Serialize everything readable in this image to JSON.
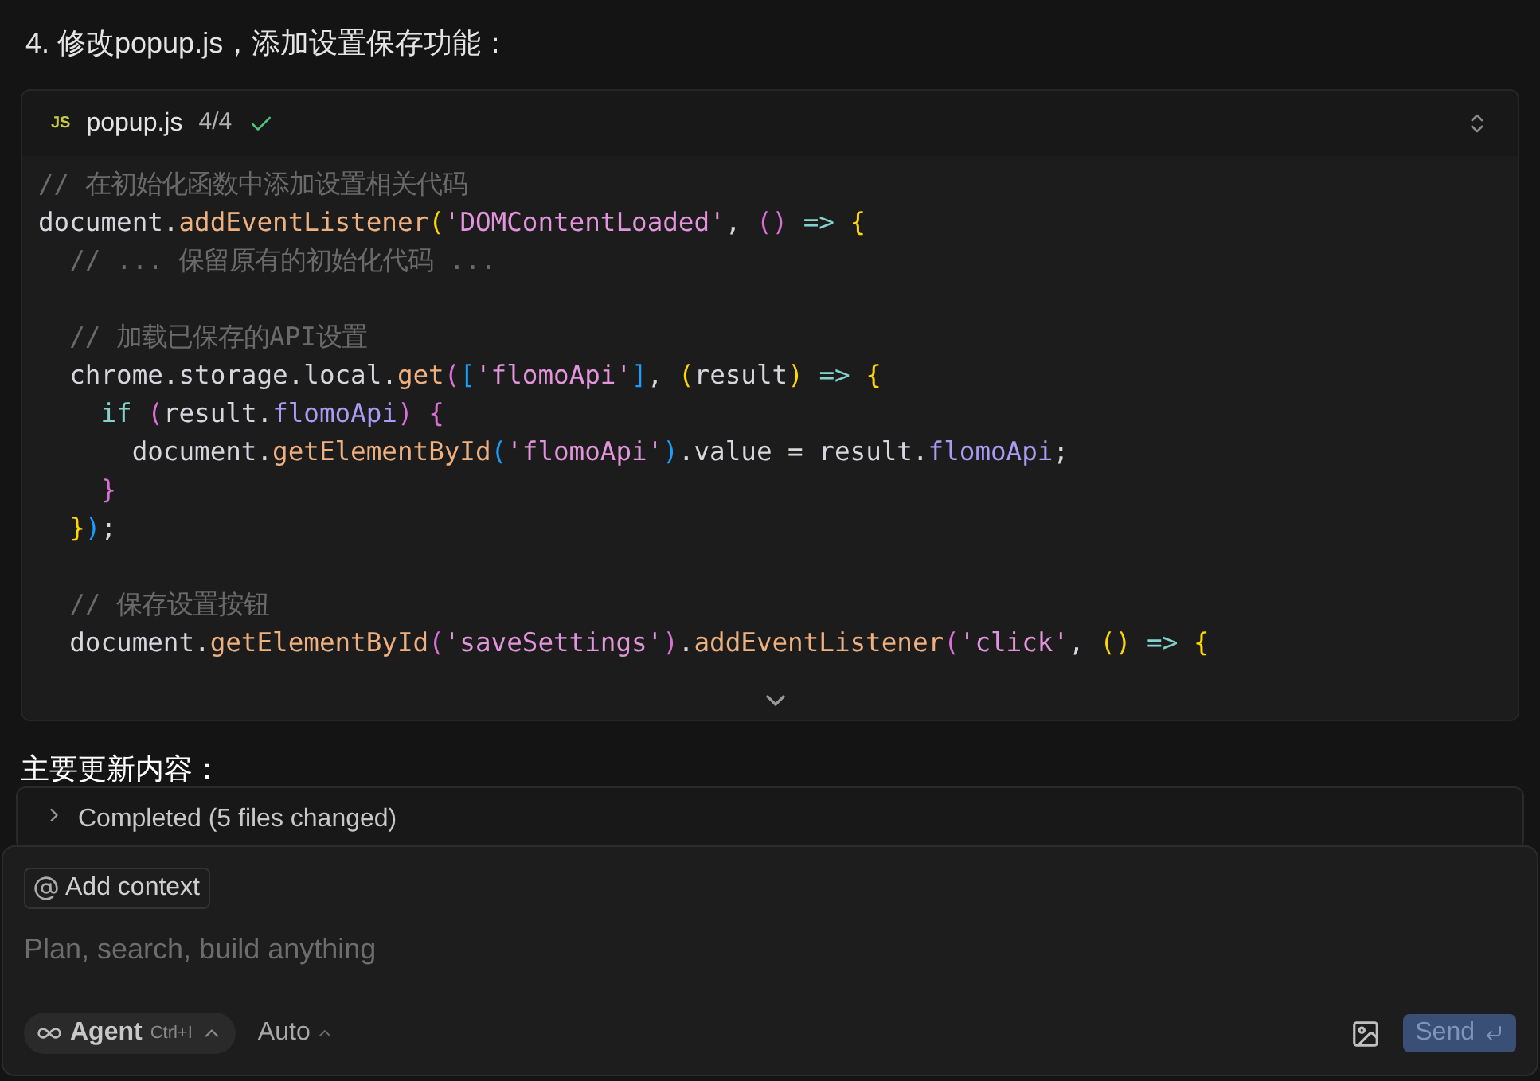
{
  "heading": "4. 修改popup.js，添加设置保存功能：",
  "code_block": {
    "badge": "JS",
    "filename": "popup.js",
    "progress": "4/4",
    "done": true,
    "blocks": [
      [
        [
          {
            "t": "// 在初始化函数中添加设置相关代码",
            "color": "#6a6a6a"
          }
        ],
        [
          {
            "t": "document.",
            "color": "#d6d6dd"
          },
          {
            "t": "addEventListener",
            "color": "#efb080"
          },
          {
            "t": "(",
            "color": "#ffd700"
          },
          {
            "t": "'DOMContentLoaded'",
            "color": "#e394dc"
          },
          {
            "t": ", ",
            "color": "#d6d6dd"
          },
          {
            "t": "()",
            "color": "#da70d6"
          },
          {
            "t": " => ",
            "color": "#82d2ce"
          },
          {
            "t": "{",
            "color": "#ffd700"
          }
        ],
        [
          {
            "t": "  // ... 保留原有的初始化代码 ...",
            "color": "#6a6a6a"
          }
        ]
      ],
      [
        [
          {
            "t": "  // 加载已保存的API设置",
            "color": "#6a6a6a"
          }
        ],
        [
          {
            "t": "  chrome.storage.local.",
            "color": "#d6d6dd"
          },
          {
            "t": "get",
            "color": "#efb080"
          },
          {
            "t": "(",
            "color": "#da70d6"
          },
          {
            "t": "[",
            "color": "#179fff"
          },
          {
            "t": "'flomoApi'",
            "color": "#e394dc"
          },
          {
            "t": "]",
            "color": "#179fff"
          },
          {
            "t": ", ",
            "color": "#d6d6dd"
          },
          {
            "t": "(",
            "color": "#ffd700"
          },
          {
            "t": "result",
            "color": "#d6d6dd"
          },
          {
            "t": ")",
            "color": "#ffd700"
          },
          {
            "t": " => ",
            "color": "#82d2ce"
          },
          {
            "t": "{",
            "color": "#ffd700"
          }
        ],
        [
          {
            "t": "    if ",
            "color": "#82d2ce"
          },
          {
            "t": "(",
            "color": "#da70d6"
          },
          {
            "t": "result.",
            "color": "#d6d6dd"
          },
          {
            "t": "flomoApi",
            "color": "#aa9bf5"
          },
          {
            "t": ") {",
            "color": "#da70d6"
          }
        ],
        [
          {
            "t": "      document.",
            "color": "#d6d6dd"
          },
          {
            "t": "getElementById",
            "color": "#efb080"
          },
          {
            "t": "(",
            "color": "#179fff"
          },
          {
            "t": "'flomoApi'",
            "color": "#e394dc"
          },
          {
            "t": ")",
            "color": "#179fff"
          },
          {
            "t": ".value = result.",
            "color": "#d6d6dd"
          },
          {
            "t": "flomoApi",
            "color": "#aa9bf5"
          },
          {
            "t": ";",
            "color": "#d6d6dd"
          }
        ],
        [
          {
            "t": "    }",
            "color": "#da70d6"
          }
        ],
        [
          {
            "t": "  }",
            "color": "#ffd700"
          },
          {
            "t": ")",
            "color": "#179fff"
          },
          {
            "t": ";",
            "color": "#d6d6dd"
          }
        ]
      ],
      [
        [
          {
            "t": "  // 保存设置按钮",
            "color": "#6a6a6a"
          }
        ],
        [
          {
            "t": "  document.",
            "color": "#d6d6dd"
          },
          {
            "t": "getElementById",
            "color": "#efb080"
          },
          {
            "t": "(",
            "color": "#da70d6"
          },
          {
            "t": "'saveSettings'",
            "color": "#e394dc"
          },
          {
            "t": ")",
            "color": "#da70d6"
          },
          {
            "t": ".",
            "color": "#d6d6dd"
          },
          {
            "t": "addEventListener",
            "color": "#efb080"
          },
          {
            "t": "(",
            "color": "#da70d6"
          },
          {
            "t": "'click'",
            "color": "#e394dc"
          },
          {
            "t": ", ",
            "color": "#d6d6dd"
          },
          {
            "t": "()",
            "color": "#ffd700"
          },
          {
            "t": " => ",
            "color": "#82d2ce"
          },
          {
            "t": "{",
            "color": "#ffd700"
          }
        ]
      ]
    ]
  },
  "summary_heading": "主要更新内容：",
  "status": {
    "label": "Completed (5 files changed)",
    "expanded": false
  },
  "composer": {
    "context_button": "Add context",
    "placeholder": "Plan, search, build anything",
    "mode": "Agent",
    "shortcut": "Ctrl+I",
    "model": "Auto",
    "send": "Send"
  }
}
